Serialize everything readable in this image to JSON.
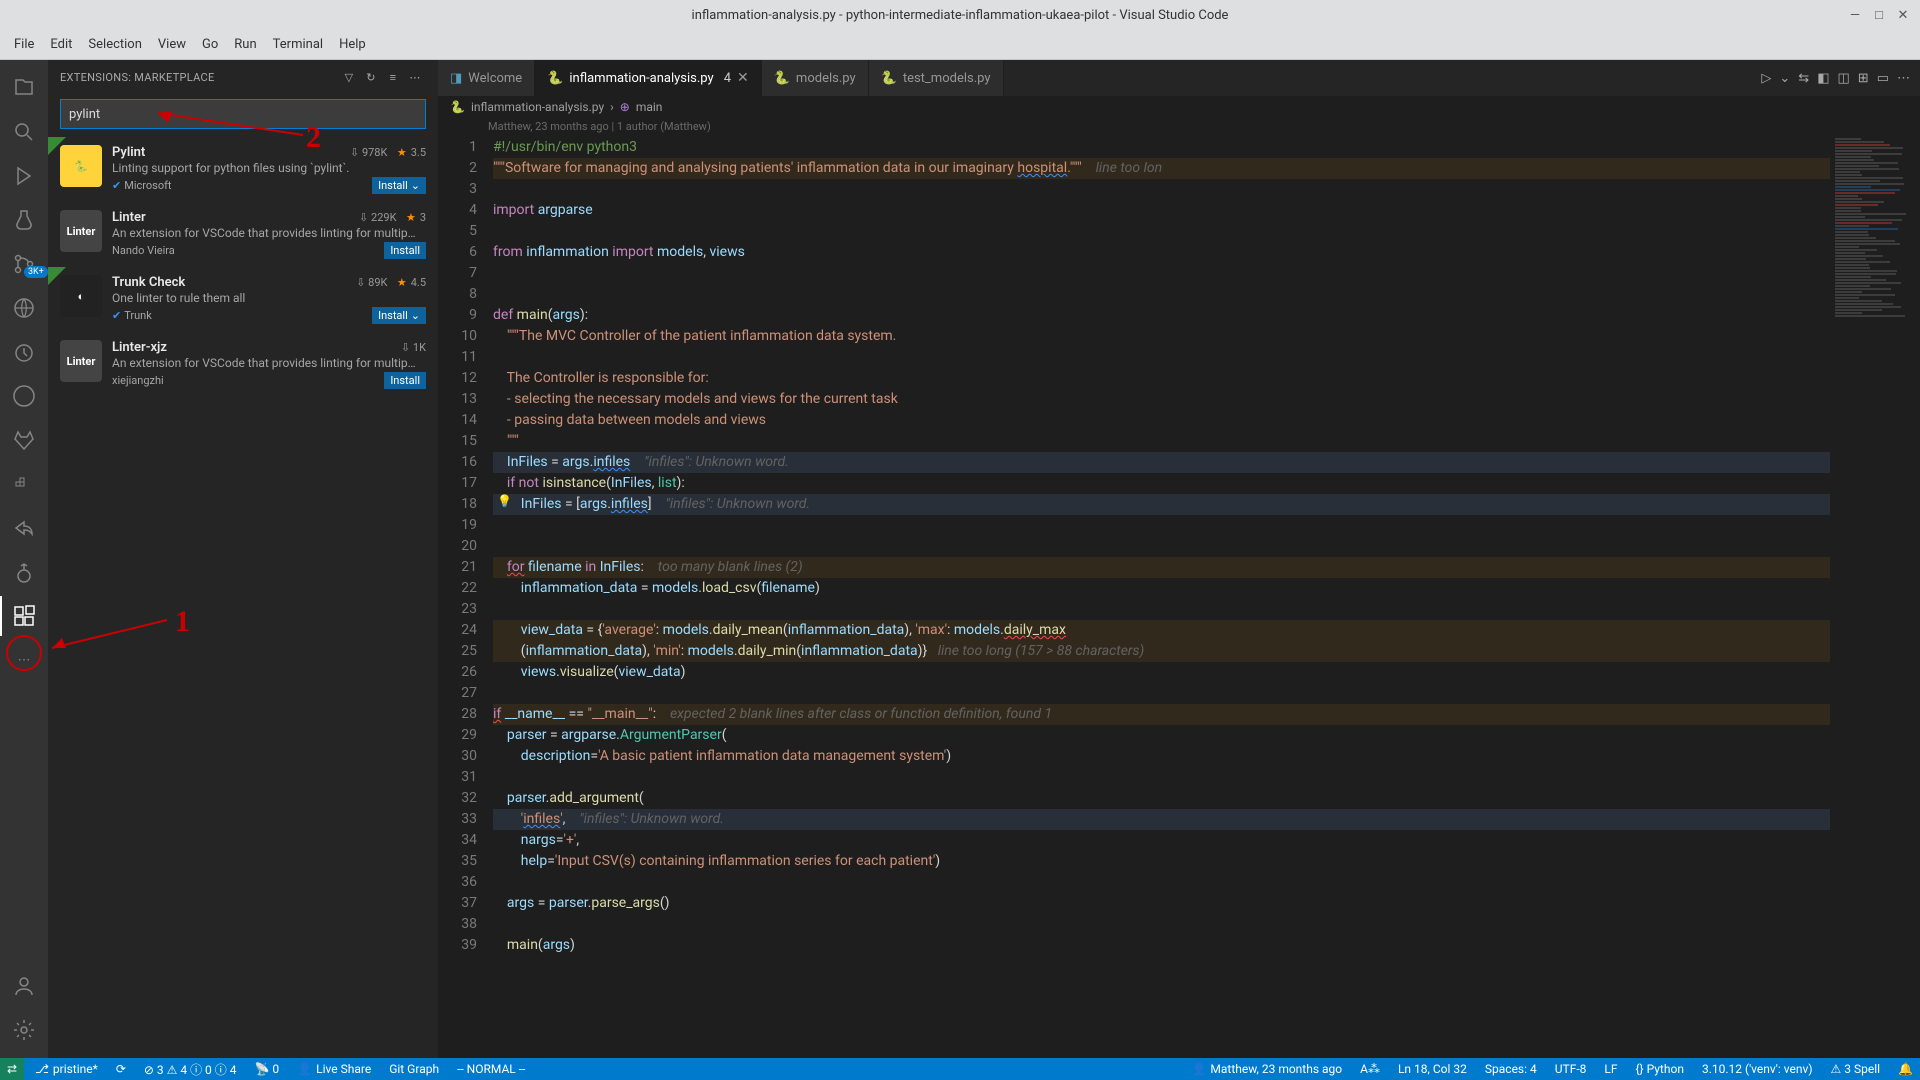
{
  "title": "inflammation-analysis.py - python-intermediate-inflammation-ukaea-pilot - Visual Studio Code",
  "menu": [
    "File",
    "Edit",
    "Selection",
    "View",
    "Go",
    "Run",
    "Terminal",
    "Help"
  ],
  "sidebar": {
    "header": "EXTENSIONS: MARKETPLACE",
    "search": "pylint",
    "items": [
      {
        "name": "Pylint",
        "desc": "Linting support for python files using `pylint`.",
        "pub": "Microsoft",
        "installs": "978K",
        "rating": "3.5",
        "install_split": true,
        "verified": true,
        "ribbon": true,
        "iconCls": "pyicon",
        "iconTxt": "🐍"
      },
      {
        "name": "Linter",
        "desc": "An extension for VSCode that provides linting for multip…",
        "pub": "Nando Vieira",
        "installs": "229K",
        "rating": "3",
        "verified": false,
        "iconCls": "lintericon",
        "iconTxt": "Linter"
      },
      {
        "name": "Trunk Check",
        "desc": "One linter to rule them all",
        "pub": "Trunk",
        "installs": "89K",
        "rating": "4.5",
        "install_split": true,
        "verified": true,
        "ribbon": true,
        "iconCls": "trunkicon",
        "iconTxt": "◐"
      },
      {
        "name": "Linter-xjz",
        "desc": "An extension for VSCode that provides linting for multip…",
        "pub": "xiejiangzhi",
        "installs": "1K",
        "rating": "",
        "verified": false,
        "iconCls": "lintericon",
        "iconTxt": "Linter"
      }
    ],
    "install_label": "Install"
  },
  "activity_badge": "3K+",
  "tabs": [
    {
      "label": "Welcome",
      "active": false,
      "icon": "vscode"
    },
    {
      "label": "inflammation-analysis.py",
      "active": true,
      "mod": "4",
      "icon": "py",
      "close": true
    },
    {
      "label": "models.py",
      "active": false,
      "icon": "py"
    },
    {
      "label": "test_models.py",
      "active": false,
      "icon": "py"
    }
  ],
  "breadcrumb": {
    "file": "inflammation-analysis.py",
    "symbol": "main"
  },
  "blame": "Matthew, 23 months ago | 1 author (Matthew)",
  "annotations": {
    "one": "1",
    "two": "2"
  },
  "status": {
    "remote": "⇄",
    "branch": "pristine*",
    "sync": "⟳",
    "problems": "⊘ 3 ⚠ 4 ⓘ 0 ⓘ 4",
    "ports": "📡 0",
    "liveshare": "Live Share",
    "gitgraph": "Git Graph",
    "vim": "-- NORMAL --",
    "blame": "Matthew, 23 months ago",
    "ai": "A⁂",
    "pos": "Ln 18, Col 32",
    "spaces": "Spaces: 4",
    "enc": "UTF-8",
    "eol": "LF",
    "lang": "{} Python",
    "py": "3.10.12 ('venv': venv)",
    "spell": "⚠ 3 Spell",
    "bell": "🔔"
  },
  "chart_data": null
}
